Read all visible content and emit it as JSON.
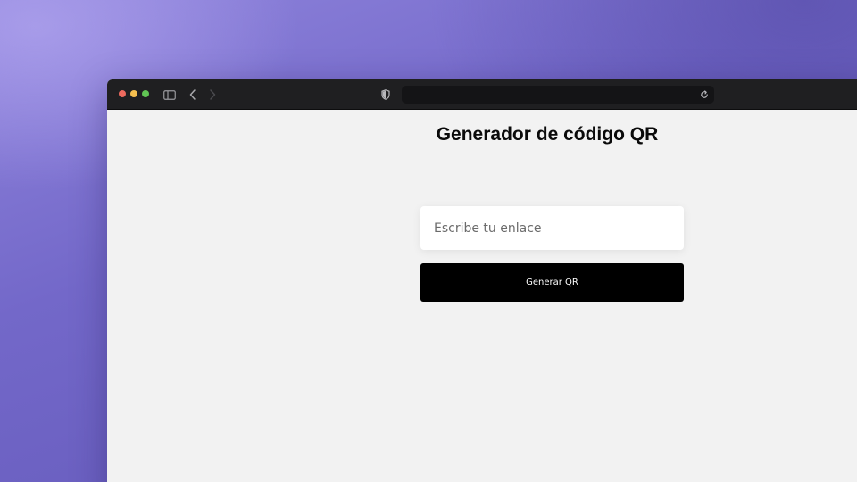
{
  "browser": {
    "address_bar": "",
    "icons": [
      "sidebar-icon",
      "chevron-left-icon",
      "chevron-right-icon",
      "shield-icon",
      "reload-icon"
    ]
  },
  "page": {
    "title": "Generador de código QR",
    "input_placeholder": "Escribe tu enlace",
    "input_value": "",
    "button_label": "Generar QR"
  },
  "colors": {
    "button_bg": "#000000",
    "page_bg": "#f2f2f2",
    "titlebar_bg": "#1f1f21"
  }
}
